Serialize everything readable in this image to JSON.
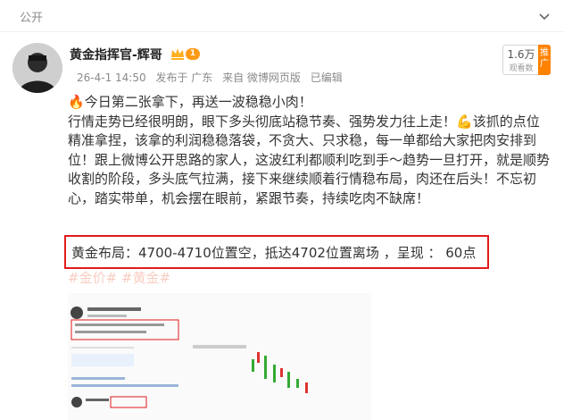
{
  "topbar": {
    "label": "公开",
    "chevron_icon": "chevron-down-icon"
  },
  "author": {
    "name": "黄金指挥官-辉哥",
    "level_badge": "1"
  },
  "meta": {
    "time": "26-4-1 14:50",
    "location": "发布于 广东",
    "source": "来自 微博网页版",
    "edited": "已编辑"
  },
  "badge": {
    "count": "1.6万",
    "caption": "观看数",
    "tag": "推广"
  },
  "post": {
    "line1": "今日第二张拿下，再送一波稳稳小肉！",
    "line2": "行情走势已经很明朗，眼下多头彻底站稳节奏、强势发力往上走！",
    "line2b": "该抓的点位",
    "line3": "精准拿捏，该拿的利润稳稳落袋，不贪大、只求稳，每一单都给大家把肉安排到",
    "line4": "位！跟上微博公开思路的家人，这波红利都顺利吃到手～趋势一旦打开，就是顺势",
    "line5": "收割的阶段，多头底气拉满，接下来继续顺着行情稳布局，肉还在后头！不忘初",
    "line6": "心，踏实带单，机会摆在眼前，紧跟节奏，持续吃肉不缺席！",
    "highlight": "黄金布局：4700-4710位置空，抵达4702位置离场 ，呈现 ： 60点",
    "tags": "#金价# #黄金#"
  },
  "colors": {
    "accent": "#ff8200",
    "highlight_border": "#e31b1b",
    "muted": "#8a8a8a"
  }
}
